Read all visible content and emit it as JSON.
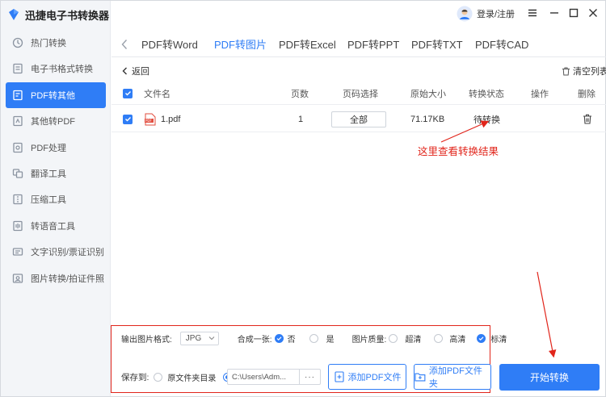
{
  "app": {
    "title": "迅捷电子书转换器"
  },
  "user": {
    "login_label": "登录/注册"
  },
  "sidebar": {
    "items": [
      {
        "label": "热门转换",
        "icon": "hot-icon"
      },
      {
        "label": "电子书格式转换",
        "icon": "ebook-icon"
      },
      {
        "label": "PDF转其他",
        "icon": "pdf-convert-icon",
        "active": true
      },
      {
        "label": "其他转PDF",
        "icon": "to-pdf-icon"
      },
      {
        "label": "PDF处理",
        "icon": "pdf-process-icon"
      },
      {
        "label": "翻译工具",
        "icon": "translate-icon"
      },
      {
        "label": "压缩工具",
        "icon": "compress-icon"
      },
      {
        "label": "转语音工具",
        "icon": "voice-icon"
      },
      {
        "label": "文字识别/票证识别",
        "icon": "ocr-icon"
      },
      {
        "label": "图片转换/拍证件照",
        "icon": "photo-icon"
      }
    ]
  },
  "tabs": [
    {
      "label": "PDF转Word"
    },
    {
      "label": "PDF转图片",
      "active": true
    },
    {
      "label": "PDF转Excel"
    },
    {
      "label": "PDF转PPT"
    },
    {
      "label": "PDF转TXT"
    },
    {
      "label": "PDF转CAD"
    }
  ],
  "toolbar": {
    "back_label": "返回",
    "clear_label": "清空列表"
  },
  "table": {
    "headers": {
      "name": "文件名",
      "pages": "页数",
      "page_select": "页码选择",
      "size": "原始大小",
      "status": "转换状态",
      "action": "操作",
      "delete": "删除"
    },
    "rows": [
      {
        "name": "1.pdf",
        "pages": "1",
        "page_select": "全部",
        "size": "71.17KB",
        "status": "待转换"
      }
    ]
  },
  "annotation": {
    "text": "这里查看转换结果"
  },
  "options": {
    "format_label": "输出图片格式:",
    "format_value": "JPG",
    "merge_label": "合成一张:",
    "merge_no": "否",
    "merge_yes": "是",
    "quality_label": "图片质量:",
    "quality_options": [
      "超清",
      "高清",
      "标清"
    ],
    "quality_selected": "标清"
  },
  "save": {
    "label": "保存到:",
    "source_dir_label": "原文件夹目录",
    "path_value": "C:\\Users\\Adm...",
    "more_label": "···"
  },
  "buttons": {
    "add_file": "添加PDF文件",
    "add_folder": "添加PDF文件夹",
    "start": "开始转换"
  },
  "colors": {
    "accent": "#2f7df6",
    "annotation": "#e1251b",
    "sidebar_bg": "#f3f5f8"
  }
}
